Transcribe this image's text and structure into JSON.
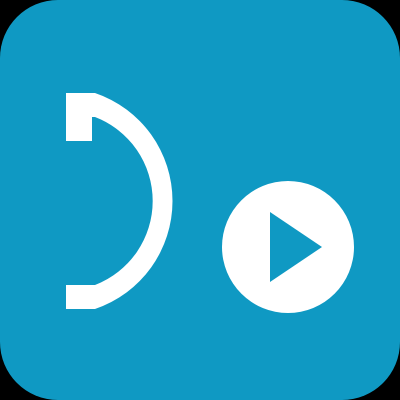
{
  "app": {
    "icon_name": "d-play-app-icon",
    "glyph_name": "d-letter-icon",
    "play_name": "play-icon"
  },
  "colors": {
    "background": "#0f99c3",
    "foreground": "#ffffff",
    "page": "#000000"
  }
}
